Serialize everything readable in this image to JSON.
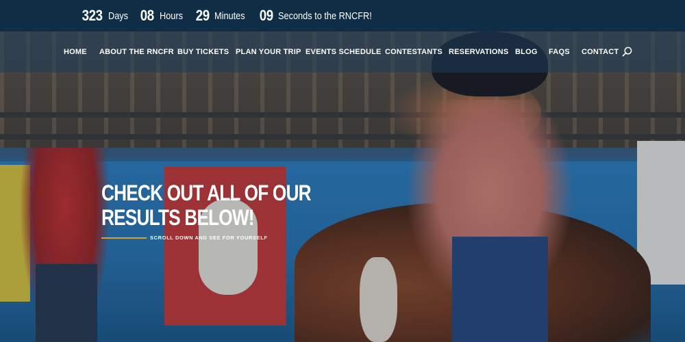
{
  "countdown": {
    "days_value": "323",
    "days_label": "Days",
    "hours_value": "08",
    "hours_label": "Hours",
    "minutes_value": "29",
    "minutes_label": "Minutes",
    "seconds_value": "09",
    "seconds_label": "Seconds to the RNCFR!"
  },
  "nav": {
    "items": [
      {
        "label": "HOME"
      },
      {
        "label": "ABOUT THE RNCFR"
      },
      {
        "label": "BUY TICKETS"
      },
      {
        "label": "PLAN YOUR TRIP"
      },
      {
        "label": "EVENTS SCHEDULE"
      },
      {
        "label": "CONTESTANTS"
      },
      {
        "label": "RESERVATIONS"
      },
      {
        "label": "BLOG"
      },
      {
        "label": "FAQS"
      },
      {
        "label": "CONTACT"
      }
    ],
    "search_icon": "search-icon"
  },
  "hero": {
    "headline": "CHECK OUT ALL OF OUR RESULTS BELOW!",
    "subheading": "SCROLL DOWN AND SEE FOR YOURSELF"
  },
  "colors": {
    "countdown_bg": "#0f2d45",
    "accent_line": "#d3a13b",
    "text": "#ffffff"
  }
}
